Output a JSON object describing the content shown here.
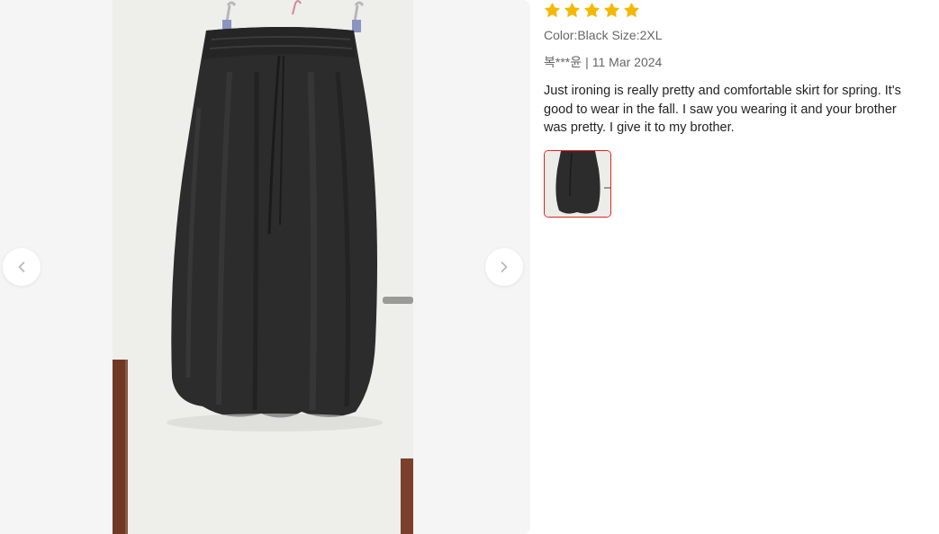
{
  "review": {
    "rating": 5,
    "rating_max": 5,
    "star_color": "#f5b800",
    "sku": "Color:Black Size:2XL",
    "author": "복***윤",
    "separator": "|",
    "date": "11 Mar 2024",
    "text": "Just ironing is really pretty and comfortable skirt for spring. It's good to wear in the fall. I saw you wearing it and your brother was pretty. I give it to my brother."
  },
  "gallery": {
    "prev_icon": "chevron-left-icon",
    "next_icon": "chevron-right-icon",
    "thumbnail_selected_border": "#e02424",
    "thumbnails_count": 1
  }
}
